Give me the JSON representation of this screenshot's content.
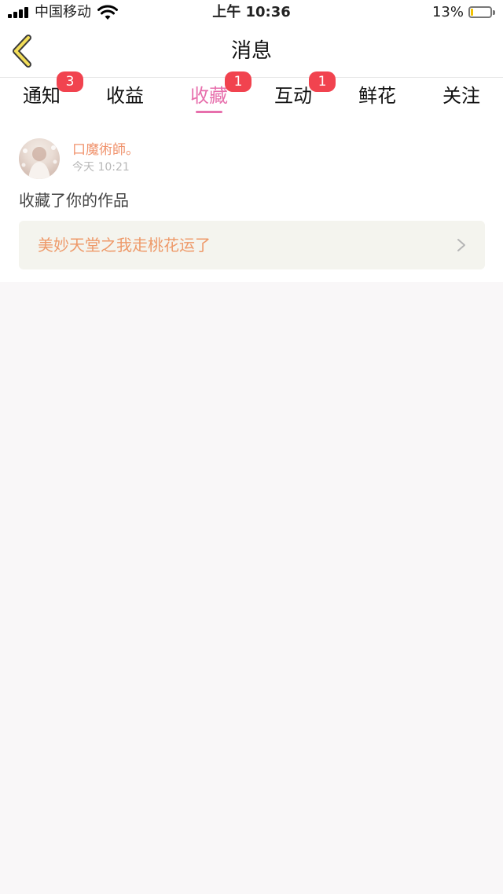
{
  "status_bar": {
    "carrier": "中国移动",
    "time": "上午 10:36",
    "battery_percent": "13%",
    "battery_level": 0.13,
    "icons": [
      "signal-icon",
      "wifi-icon",
      "battery-icon"
    ]
  },
  "nav": {
    "title": "消息",
    "back_icon": "chevron-left-icon"
  },
  "tabs": [
    {
      "label": "通知",
      "badge": "3",
      "active": false
    },
    {
      "label": "收益",
      "badge": null,
      "active": false
    },
    {
      "label": "收藏",
      "badge": "1",
      "active": true
    },
    {
      "label": "互动",
      "badge": "1",
      "active": false
    },
    {
      "label": "鲜花",
      "badge": null,
      "active": false
    },
    {
      "label": "关注",
      "badge": null,
      "active": false
    }
  ],
  "message": {
    "sender": "口魔術師。",
    "time": "今天 10:21",
    "text": "收藏了你的作品",
    "work_title": "美妙天堂之我走桃花运了",
    "link_icon": "chevron-right-icon"
  },
  "colors": {
    "accent_pink": "#e76fac",
    "badge_red": "#f1434f",
    "name_orange": "#f0936d",
    "work_orange": "#ee9a6a",
    "back_yellow": "#f3de58"
  }
}
